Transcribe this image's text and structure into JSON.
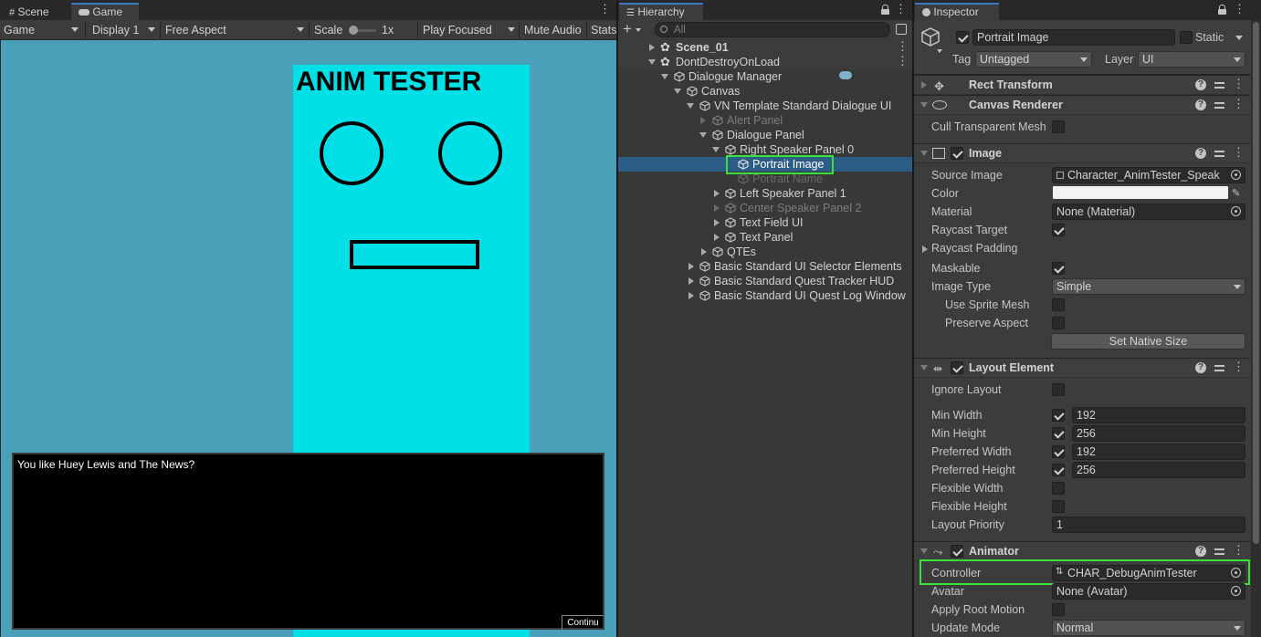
{
  "game_panel": {
    "tabs": [
      {
        "label": "Scene"
      },
      {
        "label": "Game"
      }
    ],
    "toolbar": {
      "game_dropdown": "Game",
      "display_dropdown": "Display 1",
      "aspect_dropdown": "Free Aspect",
      "scale_label": "Scale",
      "scale_value": "1x",
      "play_mode_dropdown": "Play Focused",
      "mute_audio": "Mute Audio",
      "stats": "Stats"
    },
    "view": {
      "bg_color": "#4aa0b8",
      "portrait_color": "#00e0e6",
      "portrait_title": "ANIM TESTER",
      "dialogue_text": "You like Huey Lewis and The News?",
      "continue_button": "Continu"
    }
  },
  "hierarchy": {
    "tab_label": "Hierarchy",
    "search_placeholder": "All",
    "items": [
      {
        "label": "Scene_01"
      },
      {
        "label": "DontDestroyOnLoad"
      },
      {
        "label": "Dialogue Manager"
      },
      {
        "label": "Canvas"
      },
      {
        "label": "VN Template Standard Dialogue UI"
      },
      {
        "label": "Alert Panel"
      },
      {
        "label": "Dialogue Panel"
      },
      {
        "label": "Right Speaker Panel 0"
      },
      {
        "label": "Portrait Image"
      },
      {
        "label": "Portrait Name"
      },
      {
        "label": "Left Speaker Panel 1"
      },
      {
        "label": "Center Speaker Panel 2"
      },
      {
        "label": "Text Field UI"
      },
      {
        "label": "Text Panel"
      },
      {
        "label": "QTEs"
      },
      {
        "label": "Basic Standard UI Selector Elements"
      },
      {
        "label": "Basic Standard Quest Tracker HUD"
      },
      {
        "label": "Basic Standard UI Quest Log Window"
      }
    ]
  },
  "inspector": {
    "tab_label": "Inspector",
    "object_name": "Portrait Image",
    "static_label": "Static",
    "tag_label": "Tag",
    "tag_value": "Untagged",
    "layer_label": "Layer",
    "layer_value": "UI",
    "rect_transform": {
      "title": "Rect Transform"
    },
    "canvas_renderer": {
      "title": "Canvas Renderer",
      "cull_label": "Cull Transparent Mesh"
    },
    "image": {
      "title": "Image",
      "source_image_label": "Source Image",
      "source_image_value": "Character_AnimTester_Speak",
      "color_label": "Color",
      "material_label": "Material",
      "material_value": "None (Material)",
      "raycast_target_label": "Raycast Target",
      "raycast_padding_label": "Raycast Padding",
      "maskable_label": "Maskable",
      "image_type_label": "Image Type",
      "image_type_value": "Simple",
      "use_sprite_mesh_label": "Use Sprite Mesh",
      "preserve_aspect_label": "Preserve Aspect",
      "set_native_size": "Set Native Size"
    },
    "layout_element": {
      "title": "Layout Element",
      "ignore_layout_label": "Ignore Layout",
      "min_width_label": "Min Width",
      "min_width_value": "192",
      "min_height_label": "Min Height",
      "min_height_value": "256",
      "preferred_width_label": "Preferred Width",
      "preferred_width_value": "192",
      "preferred_height_label": "Preferred Height",
      "preferred_height_value": "256",
      "flexible_width_label": "Flexible Width",
      "flexible_height_label": "Flexible Height",
      "layout_priority_label": "Layout Priority",
      "layout_priority_value": "1"
    },
    "animator": {
      "title": "Animator",
      "controller_label": "Controller",
      "controller_value": "CHAR_DebugAnimTester",
      "avatar_label": "Avatar",
      "avatar_value": "None (Avatar)",
      "apply_root_motion_label": "Apply Root Motion",
      "update_mode_label": "Update Mode",
      "update_mode_value": "Normal"
    }
  },
  "colors": {
    "highlight": "#39e23a",
    "selection": "#2c5d87",
    "tab_accent": "#3a79bb"
  }
}
